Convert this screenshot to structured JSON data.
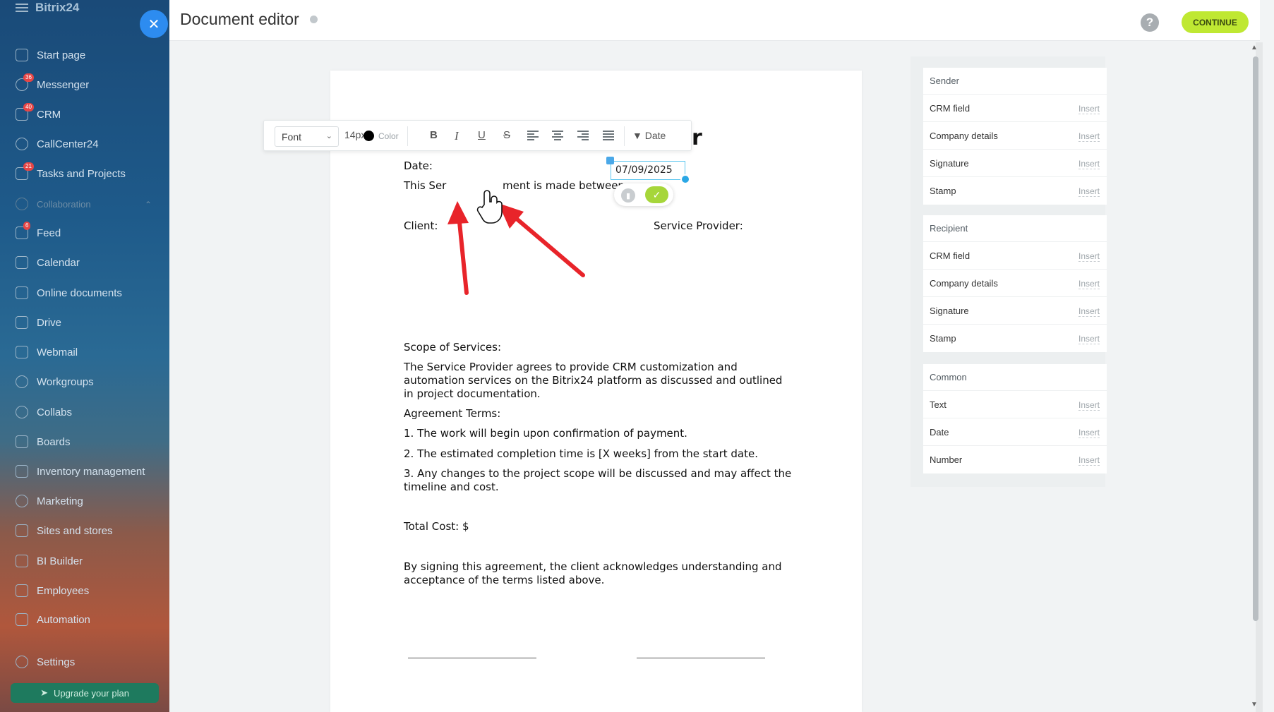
{
  "brand": {
    "logo": "Bitrix24"
  },
  "sidebar": {
    "items": [
      {
        "label": "Start page",
        "icon": "home-icon",
        "badge": ""
      },
      {
        "label": "Messenger",
        "icon": "chat-icon",
        "badge": "36"
      },
      {
        "label": "CRM",
        "icon": "crm-icon",
        "badge": "40"
      },
      {
        "label": "CallCenter24",
        "icon": "phone-icon",
        "badge": ""
      },
      {
        "label": "Tasks and Projects",
        "icon": "tasks-icon",
        "badge": "21"
      },
      {
        "label": "Collaboration",
        "icon": "collab-icon",
        "badge": ""
      },
      {
        "label": "Feed",
        "icon": "feed-icon",
        "badge": "6"
      },
      {
        "label": "Calendar",
        "icon": "calendar-icon",
        "badge": ""
      },
      {
        "label": "Online documents",
        "icon": "document-icon",
        "badge": ""
      },
      {
        "label": "Drive",
        "icon": "drive-icon",
        "badge": ""
      },
      {
        "label": "Webmail",
        "icon": "mail-icon",
        "badge": ""
      },
      {
        "label": "Workgroups",
        "icon": "group-icon",
        "badge": ""
      },
      {
        "label": "Collabs",
        "icon": "collabs-icon",
        "badge": ""
      },
      {
        "label": "Boards",
        "icon": "board-icon",
        "badge": ""
      },
      {
        "label": "Inventory management",
        "icon": "inventory-icon",
        "badge": ""
      },
      {
        "label": "Marketing",
        "icon": "marketing-icon",
        "badge": ""
      },
      {
        "label": "Sites and stores",
        "icon": "cart-icon",
        "badge": ""
      },
      {
        "label": "BI Builder",
        "icon": "chart-icon",
        "badge": ""
      },
      {
        "label": "Employees",
        "icon": "employees-icon",
        "badge": ""
      },
      {
        "label": "Automation",
        "icon": "automation-icon",
        "badge": ""
      },
      {
        "label": "Settings",
        "icon": "gear-icon",
        "badge": ""
      }
    ],
    "upgrade_label": "Upgrade your plan"
  },
  "header": {
    "title": "Document editor",
    "help": "?",
    "continue_label": "CONTINUE"
  },
  "toolbar": {
    "font": "Font",
    "size": "14px",
    "color_label": "Color",
    "bold": "B",
    "italic": "I",
    "underline": "U",
    "strike": "S",
    "date_label": "Date"
  },
  "document": {
    "title_tail": "r",
    "date_label": "Date:",
    "date_value": "07/09/2025",
    "intro_left": "This Ser",
    "intro_right": "ment is made between:",
    "client": "Client:",
    "provider": "Service Provider:",
    "scope_heading": "Scope of Services:",
    "scope_lines": [
      "The Service Provider agrees to provide CRM customization and",
      "automation services on the Bitrix24 platform as discussed and outlined",
      "in project documentation."
    ],
    "terms_heading": "Agreement Terms:",
    "term1": "1. The work will begin upon confirmation of payment.",
    "term2": "2. The estimated completion time is [X weeks] from the start date.",
    "term3_lines": [
      "3. Any changes to the project scope will be discussed and may affect the",
      "timeline and cost."
    ],
    "total": "Total Cost: $",
    "closing_lines": [
      "By signing this agreement, the client acknowledges understanding and",
      "acceptance of the terms listed above."
    ]
  },
  "insert_panel": {
    "insert_label": "Insert",
    "sections": [
      {
        "title": "Sender",
        "rows": [
          "CRM field",
          "Company details",
          "Signature",
          "Stamp"
        ]
      },
      {
        "title": "Recipient",
        "rows": [
          "CRM field",
          "Company details",
          "Signature",
          "Stamp"
        ]
      },
      {
        "title": "Common",
        "rows": [
          "Text",
          "Date",
          "Number"
        ]
      }
    ]
  },
  "colors": {
    "continue_bg": "#bfe832",
    "close_bg": "#2d8cf0",
    "confirm_bg": "#a6d63a",
    "annotation_arrow": "#e8242a"
  }
}
